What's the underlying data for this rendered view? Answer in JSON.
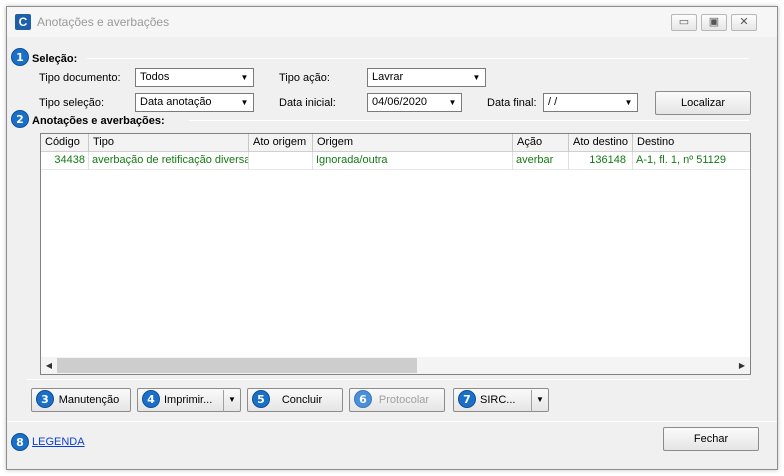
{
  "window": {
    "title": "Anotações e averbações",
    "app_icon_letter": "C",
    "controls": {
      "minimize": "▭",
      "maximize": "▣",
      "close": "✕"
    }
  },
  "badges": [
    "1",
    "2",
    "3",
    "4",
    "5",
    "6",
    "7",
    "8"
  ],
  "selection": {
    "title": "Seleção:",
    "tipo_documento": {
      "label": "Tipo documento:",
      "value": "Todos"
    },
    "tipo_acao": {
      "label": "Tipo ação:",
      "value": "Lavrar"
    },
    "tipo_selecao": {
      "label": "Tipo seleção:",
      "value": "Data anotação"
    },
    "data_inicial": {
      "label": "Data inicial:",
      "value": "04/06/2020"
    },
    "data_final": {
      "label": "Data final:",
      "value": " /  /"
    },
    "localizar_button": "Localizar"
  },
  "anotacoes": {
    "title": "Anotações e averbações:",
    "columns": [
      "Código",
      "Tipo",
      "Ato origem",
      "Origem",
      "Ação",
      "Ato destino",
      "Destino"
    ],
    "rows": [
      {
        "codigo": "34438",
        "tipo": "averbação de retificação diversa",
        "ato_origem": "",
        "origem": "Ignorada/outra",
        "acao": "averbar",
        "ato_destino": "136148",
        "destino": "A-1, fl. 1, nº 51129"
      }
    ]
  },
  "actions": {
    "manutencao": "Manutenção",
    "imprimir": "Imprimir...",
    "concluir": "Concluir",
    "protocolar": "Protocolar",
    "sirc": "SIRC..."
  },
  "footer": {
    "legenda_link": "LEGENDA",
    "fechar_button": "Fechar"
  },
  "colors": {
    "badge": "#1a6fc9",
    "row_text": "#147a14",
    "link": "#0b3fd4"
  }
}
